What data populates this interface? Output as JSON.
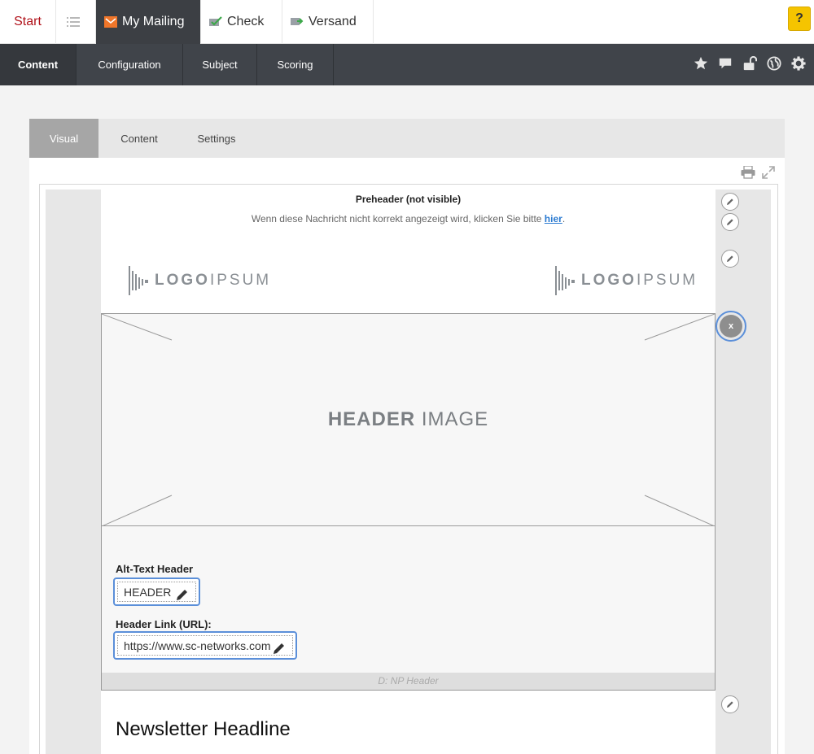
{
  "topbar": {
    "start_label": "Start",
    "tabs": [
      {
        "label": "My Mailing",
        "icon": "envelope-icon",
        "active": true
      },
      {
        "label": "Check",
        "icon": "check-icon"
      },
      {
        "label": "Versand",
        "icon": "send-icon"
      }
    ],
    "help_label": "?"
  },
  "subnav": {
    "items": [
      {
        "label": "Content",
        "active": true
      },
      {
        "label": "Configuration"
      },
      {
        "label": "Subject"
      },
      {
        "label": "Scoring"
      }
    ],
    "icons": [
      "star-icon",
      "comment-icon",
      "unlock-icon",
      "globe-icon",
      "gear-icon"
    ]
  },
  "panel": {
    "tabs": [
      {
        "label": "Visual",
        "active": true
      },
      {
        "label": "Content"
      },
      {
        "label": "Settings"
      }
    ]
  },
  "preheader": {
    "title": "Preheader (not visible)",
    "text": "Wenn diese Nachricht nicht korrekt angezeigt wird, klicken Sie bitte ",
    "link": "hier",
    "suffix": "."
  },
  "logos": {
    "bold": "LOGO",
    "light": "IPSUM"
  },
  "header_block": {
    "image_bold": "HEADER",
    "image_light": " IMAGE",
    "alt_label": "Alt-Text Header",
    "alt_value": "HEADER",
    "link_label": "Header Link (URL):",
    "link_value": "https://www.sc-networks.com",
    "footer": "D: NP Header",
    "close_label": "x"
  },
  "headline": "Newsletter Headline",
  "colors": {
    "accent": "#b0121a",
    "dark_nav": "#40444a",
    "help": "#f5c400",
    "focus": "#5b8fd9"
  }
}
